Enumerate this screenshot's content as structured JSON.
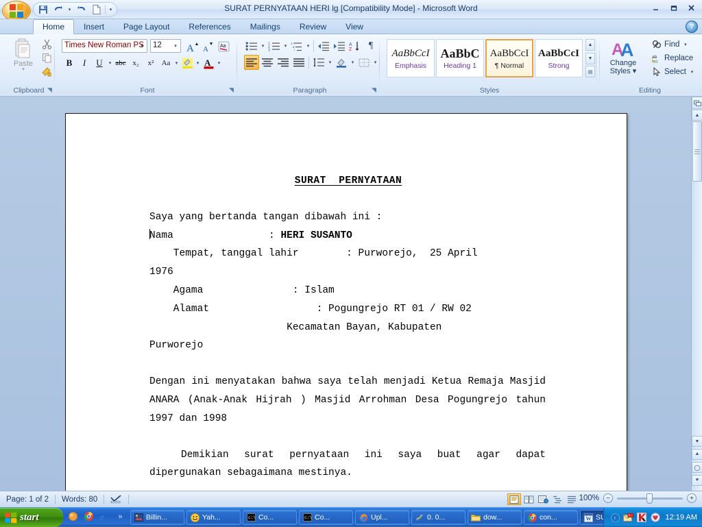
{
  "window": {
    "title": "SURAT PERNYATAAN HERI lg [Compatibility Mode] - Microsoft Word",
    "minimize": "–",
    "maximize": "❐",
    "close": "✕",
    "help": "?"
  },
  "quick_access": {
    "save": "Save",
    "undo": "Undo",
    "undo_dropdown": "▾",
    "redo": "Redo",
    "new": "New",
    "customize": "▾"
  },
  "tabs": [
    {
      "label": "Home",
      "active": true
    },
    {
      "label": "Insert",
      "active": false
    },
    {
      "label": "Page Layout",
      "active": false
    },
    {
      "label": "References",
      "active": false
    },
    {
      "label": "Mailings",
      "active": false
    },
    {
      "label": "Review",
      "active": false
    },
    {
      "label": "View",
      "active": false
    }
  ],
  "ribbon": {
    "clipboard": {
      "label": "Clipboard",
      "paste": "Paste",
      "paste_arrow": "▾",
      "cut": "Cut",
      "copy": "Copy",
      "format_painter": "Format Painter",
      "launcher": "◥"
    },
    "font": {
      "label": "Font",
      "font_name": "Times New Roman PS M",
      "font_size": "12",
      "grow_font": "A",
      "shrink_font": "A",
      "clear_formatting": "Aa",
      "bold": "B",
      "italic": "I",
      "underline": "U",
      "strikethrough": "abc",
      "subscript": "x₂",
      "superscript": "x²",
      "change_case": "Aa",
      "highlight": "ab",
      "font_color": "A",
      "arrow": "▾",
      "launcher": "◥"
    },
    "paragraph": {
      "label": "Paragraph",
      "bullets": "Bullets",
      "numbering": "Numbering",
      "multilevel": "Multilevel List",
      "decrease_indent": "Decrease Indent",
      "increase_indent": "Increase Indent",
      "sort": "Sort",
      "show_marks": "¶",
      "align_left": "Align Left",
      "align_center": "Center",
      "align_right": "Align Right",
      "justify": "Justify",
      "line_spacing": "Line Spacing",
      "shading": "Shading",
      "borders": "Borders",
      "arrow": "▾",
      "launcher": "◥"
    },
    "styles": {
      "label": "Styles",
      "items": [
        {
          "preview": "AaBbCcI",
          "name": "Emphasis",
          "selected": false
        },
        {
          "preview": "AaBbC",
          "name": "Heading 1",
          "selected": false
        },
        {
          "preview": "AaBbCcI",
          "name": "¶ Normal",
          "selected": true
        },
        {
          "preview": "AaBbCcI",
          "name": "Strong",
          "selected": false
        }
      ],
      "scroll_up": "▲",
      "scroll_down": "▼",
      "more": "▤",
      "launcher": "◥"
    },
    "editing": {
      "label": "Editing",
      "change_styles_line1": "Change",
      "change_styles_line2": "Styles",
      "change_styles_arrow": "▾",
      "find": "Find",
      "find_arrow": "▾",
      "replace": "Replace",
      "select": "Select",
      "select_arrow": "▾"
    }
  },
  "document": {
    "heading": "SURAT  PERNYATAAN",
    "lines": [
      {
        "text": "Saya yang bertanda tangan dibawah ini :",
        "type": "plain"
      },
      {
        "text": "Nama                : ",
        "bold_tail": "HERI SUSANTO",
        "type": "caret"
      },
      {
        "text": "    Tempat, tanggal lahir        : Purworejo,  25 April",
        "type": "plain"
      },
      {
        "text": "1976",
        "type": "plain"
      },
      {
        "text": "    Agama               : Islam",
        "type": "plain"
      },
      {
        "text": "    Alamat                  : Pogungrejo RT 01 / RW 02",
        "type": "plain"
      },
      {
        "text": "                       Kecamatan Bayan, Kabupaten",
        "type": "plain"
      },
      {
        "text": "Purworejo",
        "type": "plain"
      },
      {
        "text": "",
        "type": "plain"
      },
      {
        "text": "Dengan ini menyatakan bahwa saya telah menjadi Ketua Remaja Masjid ANARA (Anak-Anak Hijrah ) Masjid Arrohman Desa Pogungrejo tahun 1997 dan 1998",
        "type": "just"
      },
      {
        "text": "",
        "type": "plain"
      },
      {
        "text": "    Demikian surat pernyataan ini saya buat agar dapat dipergunakan sebagaimana mestinya.",
        "type": "just-indent"
      }
    ]
  },
  "status_bar": {
    "page": "Page: 1 of 2",
    "words": "Words: 80",
    "proofing": "Proofing errors icon",
    "views": [
      {
        "name": "print-layout",
        "selected": true
      },
      {
        "name": "full-screen-reading",
        "selected": false
      },
      {
        "name": "web-layout",
        "selected": false
      },
      {
        "name": "outline",
        "selected": false
      },
      {
        "name": "draft",
        "selected": false
      }
    ],
    "zoom": "100%",
    "zoom_out": "−",
    "zoom_in": "+"
  },
  "taskbar": {
    "start": "start",
    "quick_launch": [
      "show-desktop-icon",
      "chrome-icon",
      "internet-explorer-icon",
      "more-chevron-icon"
    ],
    "more_chevron": "»",
    "tasks": [
      {
        "label": "Billin...",
        "icon": "image-icon",
        "active": false
      },
      {
        "label": "Yah...",
        "icon": "yahoo-messenger-icon",
        "active": false
      },
      {
        "label": "Co...",
        "icon": "console-icon",
        "active": false
      },
      {
        "label": "Co...",
        "icon": "console-icon",
        "active": false
      },
      {
        "label": "Upl...",
        "icon": "firefox-icon",
        "active": false
      },
      {
        "label": "0. 0...",
        "icon": "link-icon",
        "active": false
      },
      {
        "label": "dow...",
        "icon": "folder-icon",
        "active": false
      },
      {
        "label": "con...",
        "icon": "chrome-icon",
        "active": false
      },
      {
        "label": "SUR...",
        "icon": "word-icon",
        "active": true
      }
    ],
    "tray": {
      "chevron": "‹",
      "icons": [
        "mail-icon",
        "kaspersky-icon",
        "heart-icon"
      ],
      "clock": "12:19 AM"
    }
  }
}
